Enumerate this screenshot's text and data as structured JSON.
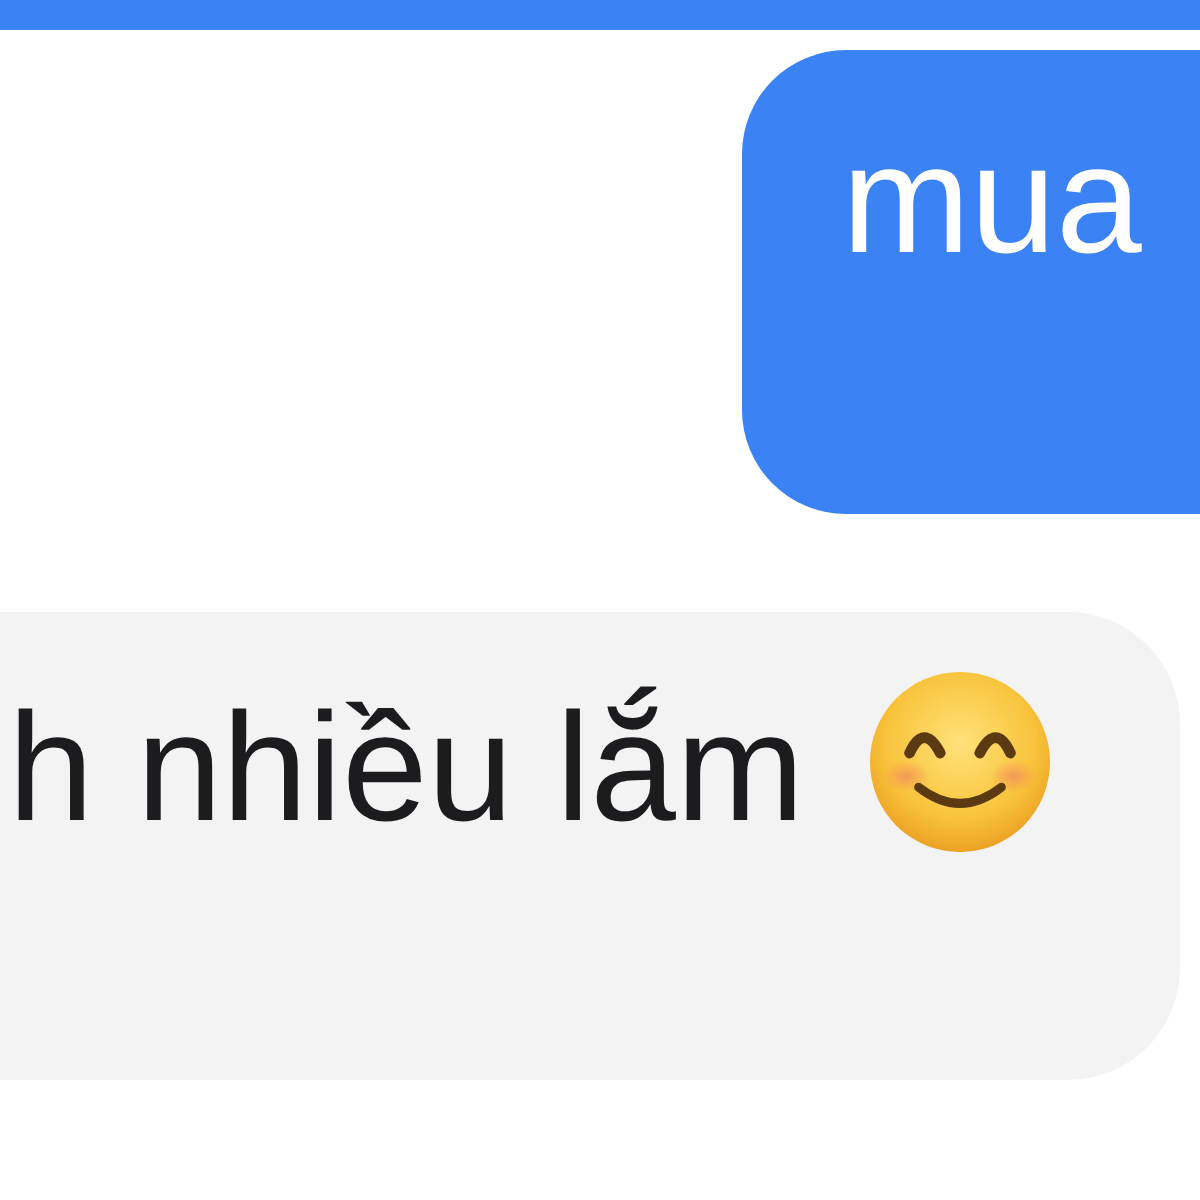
{
  "messages": [
    {
      "kind": "sent",
      "text": "mua"
    },
    {
      "kind": "received",
      "text": "h nhiều lắm",
      "emoji": true
    }
  ]
}
